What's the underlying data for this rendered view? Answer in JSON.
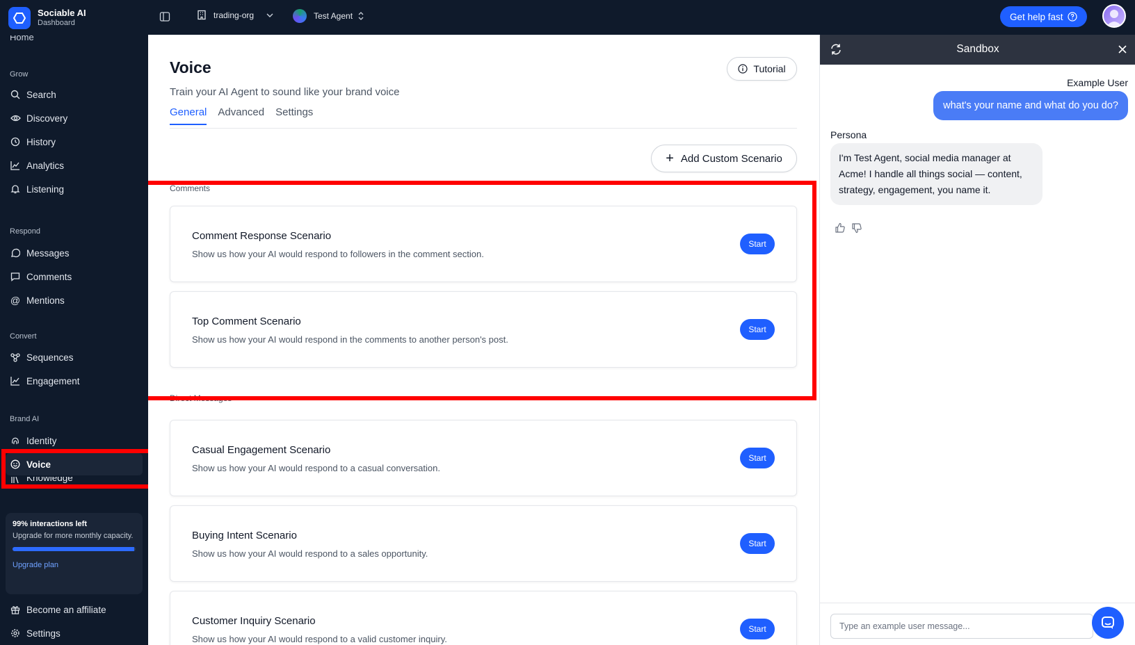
{
  "brand": {
    "name": "Sociable AI",
    "subtitle": "Dashboard"
  },
  "sidebar": {
    "cut_item": "Home",
    "sections": {
      "grow": "Grow",
      "respond": "Respond",
      "convert": "Convert",
      "brand_ai": "Brand AI"
    },
    "items": {
      "search": "Search",
      "discovery": "Discovery",
      "history": "History",
      "analytics": "Analytics",
      "listening": "Listening",
      "messages": "Messages",
      "comments": "Comments",
      "mentions": "Mentions",
      "sequences": "Sequences",
      "engagement": "Engagement",
      "identity": "Identity",
      "voice": "Voice",
      "knowledge": "Knowledge",
      "affiliate": "Become an affiliate",
      "settings": "Settings"
    },
    "upgrade": {
      "title": "99% interactions left",
      "subtitle": "Upgrade for more monthly capacity.",
      "progress": 0.99,
      "link": "Upgrade plan"
    }
  },
  "topbar": {
    "org": "trading-org",
    "agent": "Test Agent",
    "help": "Get help fast"
  },
  "main": {
    "title": "Voice",
    "subtitle": "Train your AI Agent to sound like your brand voice",
    "tutorial": "Tutorial",
    "tabs": [
      "General",
      "Advanced",
      "Settings"
    ],
    "add_scenario": "Add Custom Scenario",
    "groups": {
      "comments": "Comments",
      "direct_messages": "Direct Messages"
    },
    "start_label": "Start",
    "scenarios": [
      {
        "title": "Comment Response Scenario",
        "desc": "Show us how your AI would respond to followers in the comment section."
      },
      {
        "title": "Top Comment Scenario",
        "desc": "Show us how your AI would respond in the comments to another person's post."
      },
      {
        "title": "Casual Engagement Scenario",
        "desc": "Show us how your AI would respond to a casual conversation."
      },
      {
        "title": "Buying Intent Scenario",
        "desc": "Show us how your AI would respond to a sales opportunity."
      },
      {
        "title": "Customer Inquiry Scenario",
        "desc": "Show us how your AI would respond to a valid customer inquiry."
      }
    ]
  },
  "sandbox": {
    "title": "Sandbox",
    "example_user_label": "Example User",
    "user_message": "what's your name and what do you do?",
    "persona_label": "Persona",
    "persona_message": "I'm Test Agent, social media manager at Acme! I handle all things social — content, strategy, engagement, you name it.",
    "input_placeholder": "Type an example user message..."
  },
  "colors": {
    "sidebar_bg": "#0f1a2b",
    "accent": "#1f5fff",
    "highlight": "#ff0000",
    "user_bubble": "#4a7cf6"
  }
}
